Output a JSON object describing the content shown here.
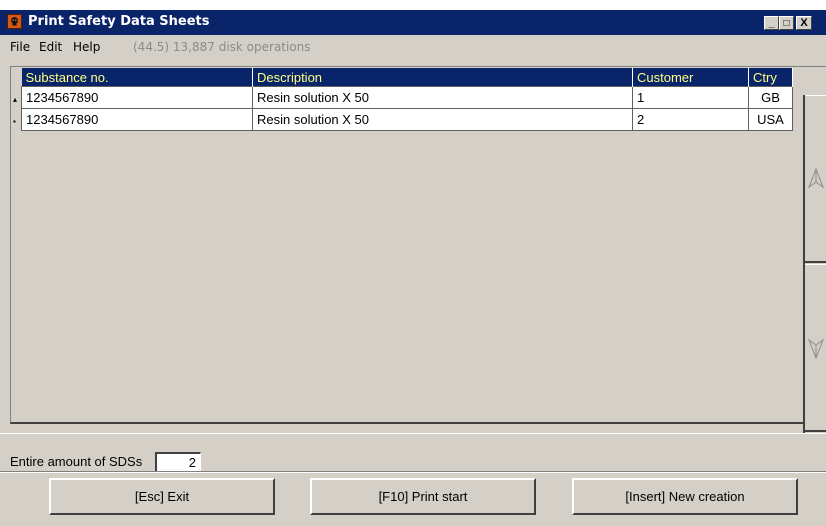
{
  "window": {
    "title": "Print Safety Data Sheets",
    "minimize": "_",
    "maximize": "□",
    "close": "X"
  },
  "menu": {
    "file": "File",
    "edit": "Edit",
    "help": "Help",
    "status": "(44.5) 13,887 disk operations"
  },
  "table": {
    "columns": [
      "Substance no.",
      "Description",
      "Customer",
      "Ctry"
    ],
    "rows": [
      {
        "substance_no": "1234567890",
        "description": "Resin solution X 50",
        "customer": "1",
        "ctry": "GB"
      },
      {
        "substance_no": "1234567890",
        "description": "Resin solution X 50",
        "customer": "2",
        "ctry": "USA"
      }
    ]
  },
  "footer": {
    "sds_label": "Entire amount of SDSs",
    "sds_value": "2"
  },
  "buttons": {
    "exit": "[Esc] Exit",
    "print": "[F10] Print start",
    "new": "[Insert] New creation"
  },
  "icons": {
    "app": "hazard-skull-icon",
    "scroll_up": "arrow-up-outline-icon",
    "scroll_down": "arrow-down-outline-icon"
  }
}
